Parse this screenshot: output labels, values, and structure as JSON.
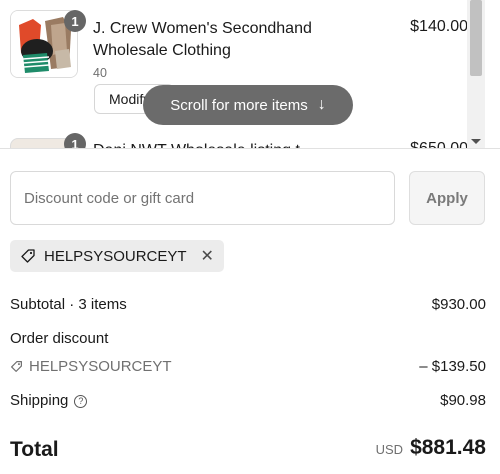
{
  "cart": {
    "items": [
      {
        "quantity": "1",
        "title": "J. Crew Women's Secondhand Wholesale Clothing",
        "variant": "40",
        "price": "$140.00",
        "modify_label": "Modify"
      },
      {
        "quantity": "1",
        "title": "Dani NWT Wholesale listing t",
        "price": "$650.00"
      }
    ],
    "scroll_hint": "Scroll for more items",
    "scroll_hint_icon": "arrow-down-icon"
  },
  "discount": {
    "placeholder": "Discount code or gift card",
    "apply_label": "Apply",
    "applied_code": "HELPSYSOURCEYT",
    "tag_icon": "tag-icon",
    "remove_icon": "close-icon"
  },
  "summary": {
    "subtotal_label": "Subtotal · 3 items",
    "subtotal_value": "$930.00",
    "order_discount_label": "Order discount",
    "order_discount_code": "HELPSYSOURCEYT",
    "order_discount_value": "– $139.50",
    "shipping_label": "Shipping",
    "shipping_value": "$90.98",
    "total_label": "Total",
    "total_currency": "USD",
    "total_value": "$881.48"
  },
  "colors": {
    "pill_bg": "#6b6b6b",
    "chip_bg": "#ececec",
    "apply_bg": "#f5f5f5"
  }
}
